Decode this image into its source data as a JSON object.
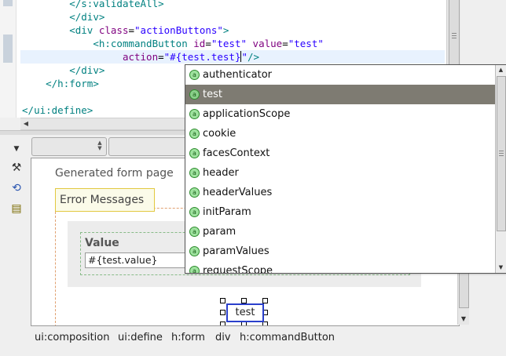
{
  "editor": {
    "lines": [
      {
        "indent": "        ",
        "open": "</",
        "tag": "s:validateAll",
        "close": ">"
      },
      {
        "indent": "        ",
        "open": "</",
        "tag": "div",
        "close": ">"
      },
      {
        "indent": "        ",
        "open": "<",
        "tag": "div",
        "attr": "class",
        "value": "\"actionButtons\"",
        "close": ">"
      },
      {
        "indent": "            ",
        "open": "<",
        "tag": "h:commandButton",
        "attr": "id",
        "value": "\"test\"",
        "attr2": "value",
        "value2": "\"test\""
      },
      {
        "indent": "                ",
        "attr": "action",
        "value_before_caret": "\"#{test.test}",
        "value_after_caret": "\"",
        "close": "/>"
      },
      {
        "indent": "        ",
        "open": "</",
        "tag": "div",
        "close": ">"
      },
      {
        "indent": "    ",
        "open": "</",
        "tag": "h:form",
        "close": ">"
      },
      {
        "indent": "",
        "open": "",
        "tag": "",
        "close": ""
      },
      {
        "indent": "",
        "open": "</",
        "tag": "ui:define",
        "close": ">"
      }
    ]
  },
  "canvas": {
    "page_title": "Generated form page",
    "error_messages": "Error Messages",
    "value_label": "Value",
    "value_input": "#{test.value}",
    "button_label": "test"
  },
  "autocomplete": {
    "selected_index": 1,
    "icon_glyph": "a",
    "items": [
      "authenticator",
      "test",
      "applicationScope",
      "cookie",
      "facesContext",
      "header",
      "headerValues",
      "initParam",
      "param",
      "paramValues",
      "requestScope"
    ]
  },
  "breadcrumb": [
    "ui:composition",
    "ui:define",
    "h:form",
    "div",
    "h:commandButton"
  ],
  "icons": {
    "menu": "chevron-down-icon",
    "tools": "tools-icon",
    "refresh": "refresh-icon",
    "preview": "preview-icon"
  },
  "colors": {
    "tag": "#008080",
    "attribute": "#7f007f",
    "string": "#2a00ff",
    "selection": "#7e7b72",
    "selected_outline": "#2a3fcc"
  }
}
